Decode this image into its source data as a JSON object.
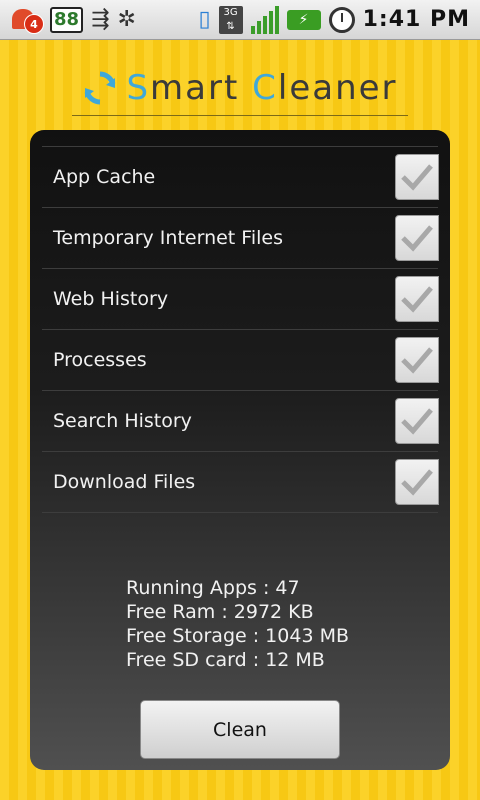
{
  "status_bar": {
    "notification_count": "4",
    "battery_percent_badge": "88",
    "network_label": "3G",
    "time": "1:41 PM",
    "icons": [
      "notification-icon",
      "battery-percent-icon",
      "usb-icon",
      "android-debug-icon",
      "vibrate-icon",
      "3g-icon",
      "signal-icon",
      "charging-battery-icon",
      "alarm-clock-icon"
    ]
  },
  "header": {
    "title_first_initial": "S",
    "title_first_rest": "mart ",
    "title_second_initial": "C",
    "title_second_rest": "leaner",
    "icon": "refresh-icon"
  },
  "options": [
    {
      "label": "App Cache",
      "checked": true
    },
    {
      "label": "Temporary Internet Files",
      "checked": true
    },
    {
      "label": "Web History",
      "checked": true
    },
    {
      "label": "Processes",
      "checked": true
    },
    {
      "label": "Search History",
      "checked": true
    },
    {
      "label": "Download Files",
      "checked": true
    }
  ],
  "stats": {
    "running_apps": "Running Apps : 47",
    "free_ram": "Free Ram : 2972 KB",
    "free_storage": "Free Storage : 1043 MB",
    "free_sd": "Free SD card : 12 MB"
  },
  "clean_button_label": "Clean",
  "colors": {
    "accent_blue": "#3fa8d9",
    "background_yellow": "#fbd229",
    "panel_dark": "#1c1c1c"
  }
}
